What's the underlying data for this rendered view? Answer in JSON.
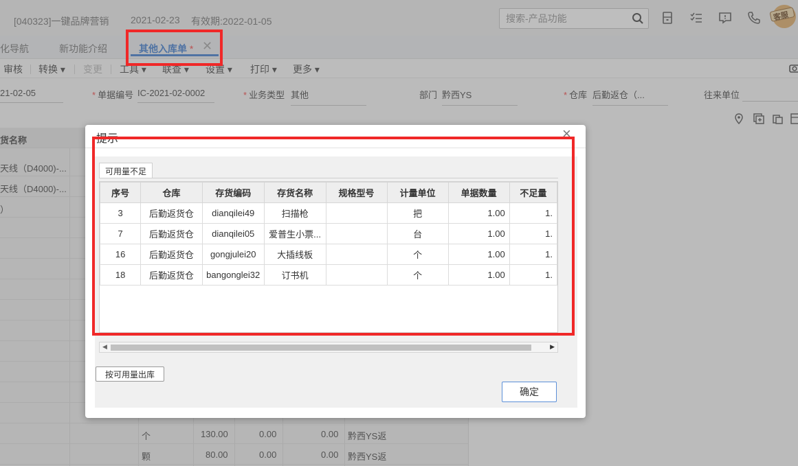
{
  "header": {
    "company": "[040323]一键品牌营销",
    "date": "2021-02-23",
    "valid": "有效期:2022-01-05",
    "search_placeholder": "搜索-产品功能",
    "avatar_label": "客服"
  },
  "tabs": [
    {
      "label": "化导航"
    },
    {
      "label": "新功能介绍"
    },
    {
      "label": "其他入库单",
      "star": "*"
    }
  ],
  "toolbar": [
    "审核",
    "转换",
    "变更",
    "工具",
    "联查",
    "设置",
    "打印",
    "更多"
  ],
  "form": {
    "date_value": "21-02-05",
    "doc_no_label": "单据编号",
    "doc_no_value": "IC-2021-02-0002",
    "biz_type_label": "业务类型",
    "biz_type_value": "其他",
    "dept_label": "部门",
    "dept_value": "黔西YS",
    "warehouse_label": "仓库",
    "warehouse_value": "后勤返仓（...",
    "partner_label": "往来单位"
  },
  "bg_table": {
    "header": "货名称",
    "rows": [
      "天线（D4000)-...",
      "天线（D4000)-...",
      "）",
      "",
      "",
      "",
      "",
      "",
      "",
      "",
      "",
      "",
      "",
      "",
      "",
      "",
      ""
    ],
    "tail_rows": [
      {
        "unit": "个",
        "qty": "130.00",
        "a": "0.00",
        "b": "0.00",
        "wh": "黔西YS返"
      },
      {
        "unit": "颗",
        "qty": "80.00",
        "a": "0.00",
        "b": "0.00",
        "wh": "黔西YS返"
      }
    ]
  },
  "dialog": {
    "title": "提示",
    "subtab": "可用量不足",
    "columns": [
      "序号",
      "仓库",
      "存货编码",
      "存货名称",
      "规格型号",
      "计量单位",
      "单据数量",
      "不足量"
    ],
    "rows": [
      {
        "seq": "3",
        "wh": "后勤返货仓",
        "code": "dianqilei49",
        "name": "扫描枪",
        "spec": "",
        "unit": "把",
        "qty": "1.00",
        "short": "1."
      },
      {
        "seq": "7",
        "wh": "后勤返货仓",
        "code": "dianqilei05",
        "name": "爱普生小票...",
        "spec": "",
        "unit": "台",
        "qty": "1.00",
        "short": "1."
      },
      {
        "seq": "16",
        "wh": "后勤返货仓",
        "code": "gongjulei20",
        "name": "大插线板",
        "spec": "",
        "unit": "个",
        "qty": "1.00",
        "short": "1."
      },
      {
        "seq": "18",
        "wh": "后勤返货仓",
        "code": "bangonglei32",
        "name": "订书机",
        "spec": "",
        "unit": "个",
        "qty": "1.00",
        "short": "1."
      }
    ],
    "btn_available": "按可用量出库",
    "btn_ok": "确定"
  },
  "colors": {
    "accent": "#2f6fc6",
    "required": "#e33333",
    "highlight_box": "#f02828"
  }
}
